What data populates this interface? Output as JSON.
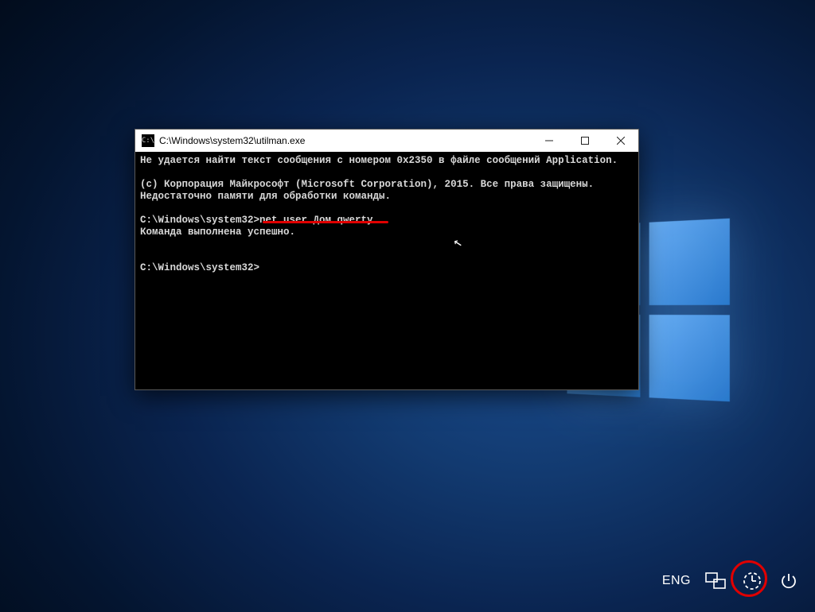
{
  "window": {
    "title": "C:\\Windows\\system32\\utilman.exe"
  },
  "terminal": {
    "line1": "Не удается найти текст сообщения с номером 0x2350 в файле сообщений Application.",
    "blank1": "",
    "line2": "(c) Корпорация Майкрософт (Microsoft Corporation), 2015. Все права защищены.",
    "line3": "Недостаточно памяти для обработки команды.",
    "blank2": "",
    "prompt1_prefix": "C:\\Windows\\system32>",
    "prompt1_command": "net user Дом qwerty",
    "line4": "Команда выполнена успешно.",
    "blank3": "",
    "blank4": "",
    "prompt2": "C:\\Windows\\system32>"
  },
  "tray": {
    "language": "ENG"
  },
  "annotations": {
    "underline_color": "#e00000",
    "circle_color": "#e00000"
  }
}
